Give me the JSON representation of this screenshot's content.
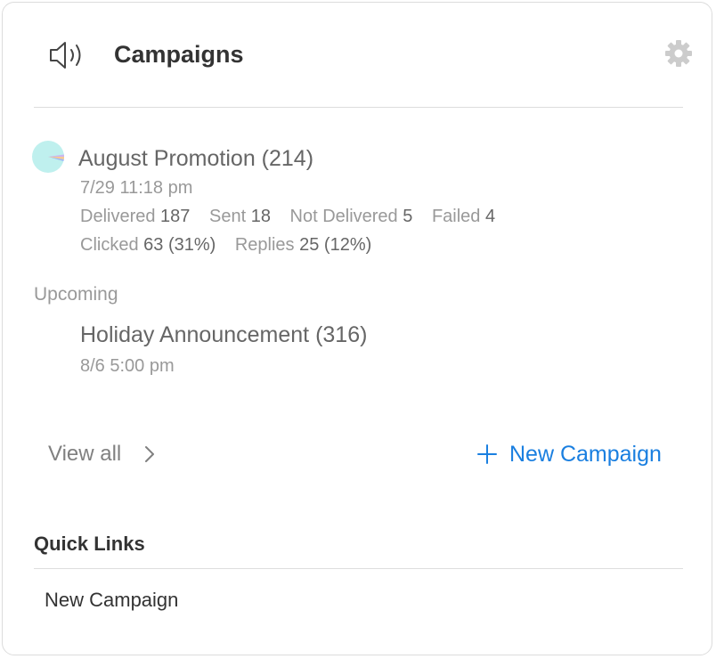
{
  "header": {
    "title": "Campaigns",
    "icon": "megaphone-icon",
    "settings_icon": "gear-icon"
  },
  "recent": {
    "title": "August Promotion (214)",
    "datetime": "7/29 11:18 pm",
    "stats": [
      {
        "label": "Delivered",
        "value": "187"
      },
      {
        "label": "Sent",
        "value": "18"
      },
      {
        "label": "Not Delivered",
        "value": "5"
      },
      {
        "label": "Failed",
        "value": "4"
      }
    ],
    "engagement": [
      {
        "label": "Clicked",
        "value": "63 (31%)"
      },
      {
        "label": "Replies",
        "value": "25 (12%)"
      }
    ]
  },
  "upcoming": {
    "label": "Upcoming",
    "title": "Holiday Announcement (316)",
    "datetime": "8/6 5:00 pm"
  },
  "actions": {
    "view_all": "View all",
    "new_campaign": "New Campaign"
  },
  "quick_links": {
    "title": "Quick Links",
    "items": [
      "New Campaign"
    ]
  },
  "colors": {
    "accent": "#1a7fe0",
    "pie_main": "#bff0ee"
  }
}
